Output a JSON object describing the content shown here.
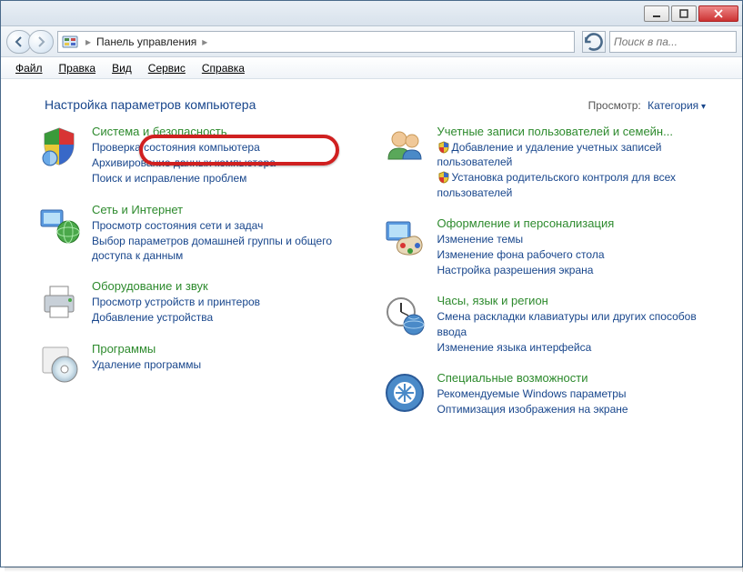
{
  "window": {
    "breadcrumb": [
      "Панель управления"
    ],
    "search_placeholder": "Поиск в па..."
  },
  "menu": [
    "Файл",
    "Правка",
    "Вид",
    "Сервис",
    "Справка"
  ],
  "heading": "Настройка параметров компьютера",
  "view_label": "Просмотр:",
  "view_value": "Категория",
  "left": [
    {
      "icon": "security-shield",
      "title": "Система и безопасность",
      "links": [
        {
          "text": "Проверка состояния компьютера"
        },
        {
          "text": "Архивирование данных компьютера"
        },
        {
          "text": "Поиск и исправление проблем"
        }
      ]
    },
    {
      "icon": "network-globe",
      "title": "Сеть и Интернет",
      "links": [
        {
          "text": "Просмотр состояния сети и задач"
        },
        {
          "text": "Выбор параметров домашней группы и общего доступа к данным"
        }
      ]
    },
    {
      "icon": "printer",
      "title": "Оборудование и звук",
      "links": [
        {
          "text": "Просмотр устройств и принтеров"
        },
        {
          "text": "Добавление устройства"
        }
      ]
    },
    {
      "icon": "programs-disc",
      "title": "Программы",
      "links": [
        {
          "text": "Удаление программы"
        }
      ]
    }
  ],
  "right": [
    {
      "icon": "users",
      "title": "Учетные записи пользователей и семейн...",
      "links": [
        {
          "text": "Добавление и удаление учетных записей пользователей",
          "shield": true
        },
        {
          "text": "Установка родительского контроля для всех пользователей",
          "shield": true
        }
      ]
    },
    {
      "icon": "appearance-palette",
      "title": "Оформление и персонализация",
      "links": [
        {
          "text": "Изменение темы"
        },
        {
          "text": "Изменение фона рабочего стола"
        },
        {
          "text": "Настройка разрешения экрана"
        }
      ]
    },
    {
      "icon": "clock-globe",
      "title": "Часы, язык и регион",
      "links": [
        {
          "text": "Смена раскладки клавиатуры или других способов ввода"
        },
        {
          "text": "Изменение языка интерфейса"
        }
      ]
    },
    {
      "icon": "ease-access",
      "title": "Специальные возможности",
      "links": [
        {
          "text": "Рекомендуемые Windows параметры"
        },
        {
          "text": "Оптимизация изображения на экране"
        }
      ]
    }
  ]
}
